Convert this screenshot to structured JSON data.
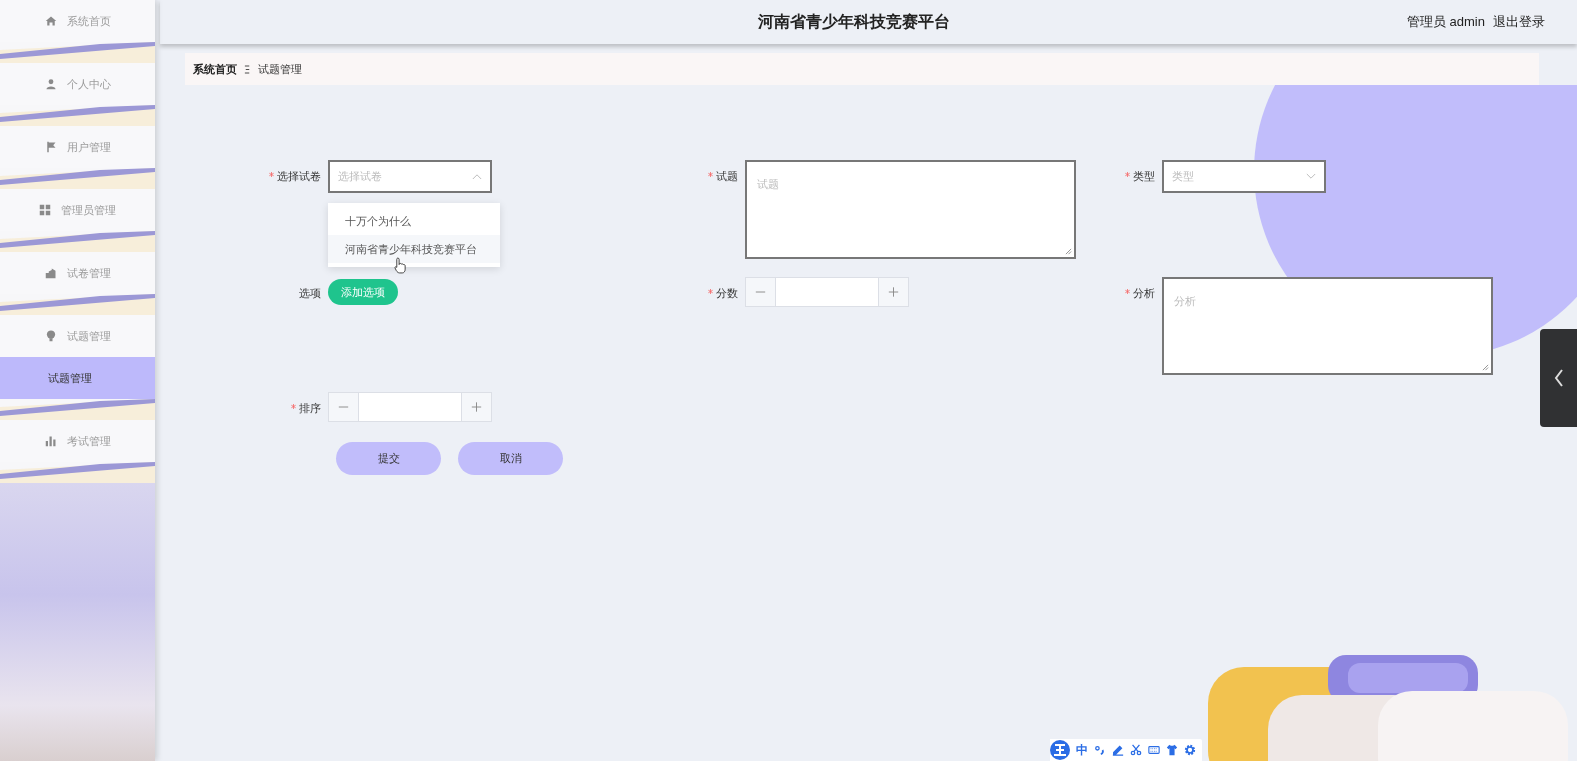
{
  "header": {
    "title": "河南省青少年科技竞赛平台",
    "user": "管理员 admin",
    "logout": "退出登录"
  },
  "sidebar": {
    "items": [
      {
        "label": "系统首页",
        "selected": false
      },
      {
        "label": "个人中心",
        "selected": false
      },
      {
        "label": "用户管理",
        "selected": false
      },
      {
        "label": "管理员管理",
        "selected": false
      },
      {
        "label": "试卷管理",
        "selected": false
      },
      {
        "label": "试题管理",
        "selected": false,
        "expanded": true,
        "children": [
          {
            "label": "试题管理",
            "selected": true
          }
        ]
      },
      {
        "label": "考试管理",
        "selected": false
      }
    ]
  },
  "breadcrumb": [
    "系统首页",
    "试题管理"
  ],
  "form": {
    "fields": [
      {
        "kind": "select",
        "label": "选择试卷",
        "required": true,
        "placeholder": "选择试卷",
        "open": true
      },
      {
        "kind": "textarea",
        "label": "试题",
        "required": true,
        "placeholder": "试题"
      },
      {
        "kind": "select",
        "label": "类型",
        "required": true,
        "placeholder": "类型",
        "open": false
      },
      {
        "kind": "button",
        "label": "选项",
        "required": false,
        "text": "添加选项"
      },
      {
        "kind": "stepper",
        "label": "分数",
        "required": true
      },
      {
        "kind": "textarea",
        "label": "分析",
        "required": true,
        "placeholder": "分析"
      },
      {
        "kind": "stepper",
        "label": "排序",
        "required": true
      }
    ],
    "buttons": [
      "提交",
      "取消"
    ]
  },
  "dropdown": {
    "options": [
      {
        "label": "十万个为什么",
        "highlighted": false
      },
      {
        "label": "河南省青少年科技竞赛平台",
        "highlighted": true
      }
    ]
  },
  "ime": {
    "mode": "中"
  }
}
